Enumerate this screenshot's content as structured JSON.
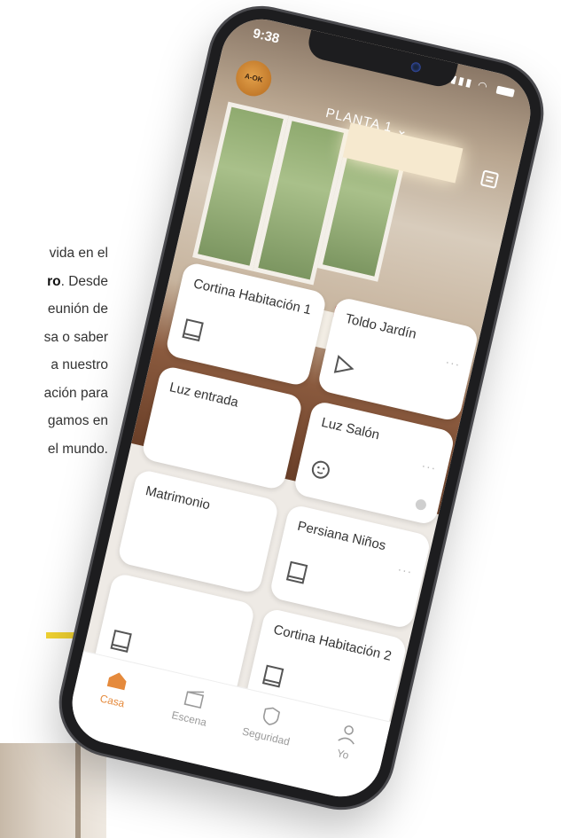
{
  "page_text": {
    "lines": [
      "vida en el",
      "ro. Desde",
      "eunión de",
      "sa o saber",
      "a nuestro",
      "ación para",
      "gamos en",
      "el mundo."
    ],
    "bold_fragment": "ro"
  },
  "status_bar": {
    "time": "9:38"
  },
  "header": {
    "logo_text": "A-OK",
    "floor_label": "PLANTA 1 ⌄"
  },
  "devices": [
    {
      "name": "Cortina Habitación 1",
      "icon": "curtain-icon",
      "more": ""
    },
    {
      "name": "Toldo Jardín",
      "icon": "awning-icon",
      "more": "···"
    },
    {
      "name": "Luz entrada",
      "icon": "outlet-icon",
      "more": ""
    },
    {
      "name": "Luz Salón",
      "icon": "outlet-icon",
      "more": "···"
    },
    {
      "name": "Matrimonio",
      "icon": "curtain-icon",
      "more": ""
    },
    {
      "name": "Persiana Niños",
      "icon": "curtain-icon",
      "more": "···"
    },
    {
      "name": "",
      "icon": "curtain-icon",
      "more": ""
    },
    {
      "name": "Cortina Habitación 2",
      "icon": "curtain-icon",
      "more": ""
    }
  ],
  "tabs": [
    {
      "label": "Casa",
      "icon": "house-icon",
      "active": true
    },
    {
      "label": "Escena",
      "icon": "scene-icon",
      "active": false
    },
    {
      "label": "Seguridad",
      "icon": "shield-icon",
      "active": false
    },
    {
      "label": "Yo",
      "icon": "user-icon",
      "active": false
    }
  ],
  "colors": {
    "accent": "#e58a3c",
    "highlight": "#f2d332"
  }
}
